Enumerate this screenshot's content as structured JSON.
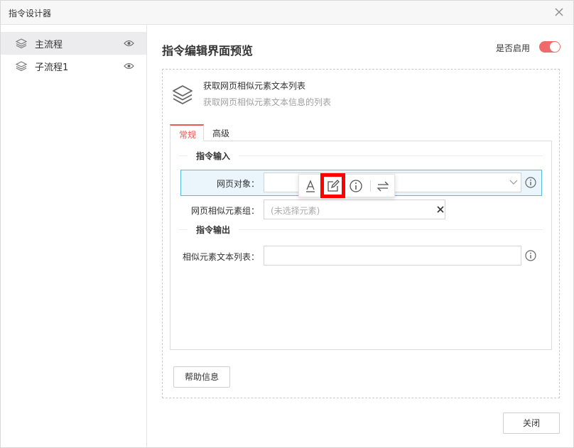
{
  "window": {
    "title": "指令设计器"
  },
  "sidebar": {
    "items": [
      {
        "label": "主流程",
        "active": true
      },
      {
        "label": "子流程1",
        "active": false
      }
    ]
  },
  "main": {
    "title": "指令编辑界面预览",
    "enable_label": "是否启用",
    "enabled": true
  },
  "command": {
    "name": "获取网页相似元素文本列表",
    "description": "获取网页相似元素文本信息的列表"
  },
  "tabs": [
    {
      "label": "常规",
      "active": true
    },
    {
      "label": "高级",
      "active": false
    }
  ],
  "sections": {
    "input": "指令输入",
    "output": "指令输出"
  },
  "fields": {
    "web_object": {
      "label": "网页对象：",
      "value": ""
    },
    "similar_group": {
      "label": "网页相似元素组：",
      "placeholder": "(未选择元素)"
    },
    "text_list": {
      "label": "相似元素文本列表：",
      "value": ""
    }
  },
  "buttons": {
    "help": "帮助信息",
    "close": "关闭"
  },
  "colors": {
    "accent": "#e95656",
    "toggle_on": "#f06a6a",
    "highlight_border": "#55bedc",
    "highlight_bg": "#eaf6fb",
    "annotation": "#ff0000"
  }
}
